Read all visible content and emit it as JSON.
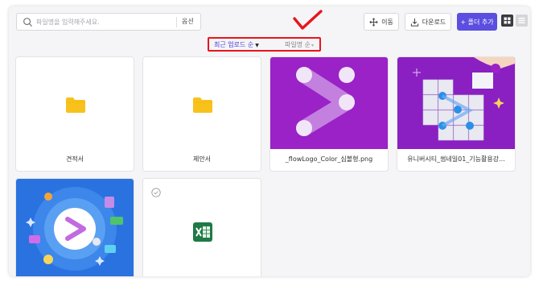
{
  "search": {
    "placeholder": "파일명을 입력해주세요.",
    "option_label": "옵션"
  },
  "toolbar": {
    "move_label": "이동",
    "download_label": "다운로드",
    "add_folder_label": "+ 폴더 추가"
  },
  "sort": {
    "active_label": "최근 업로드 순",
    "inactive_label": "파일명 순"
  },
  "items": [
    {
      "type": "folder",
      "name": "견적서"
    },
    {
      "type": "folder",
      "name": "제안서"
    },
    {
      "type": "image",
      "name": "_flowLogo_Color_심볼형.png"
    },
    {
      "type": "image",
      "name": "유니버시티_썸네일01_기능활용강..."
    },
    {
      "type": "image",
      "name": ""
    },
    {
      "type": "excel",
      "name": ""
    }
  ],
  "colors": {
    "accent": "#5b4ee0",
    "annotation_red": "#e8151d",
    "folder_yellow": "#f7c21b",
    "excel_green": "#1f7a45",
    "thumb_purple": "#9a22c7",
    "thumb_blue": "#2a72e0"
  },
  "icons": [
    "search-icon",
    "move-icon",
    "download-icon",
    "grid-view-icon",
    "list-view-icon",
    "folder-icon",
    "excel-icon",
    "checkmark-annotation-icon",
    "select-circle-icon"
  ]
}
